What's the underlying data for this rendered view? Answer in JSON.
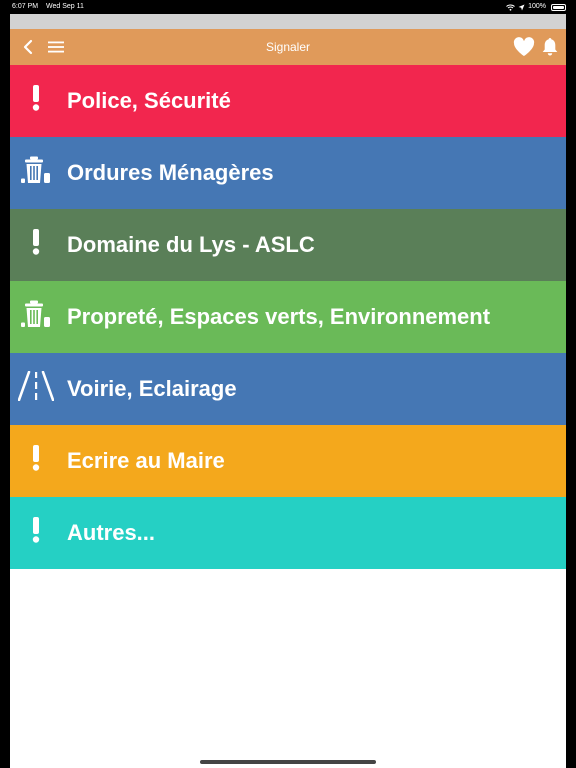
{
  "status_bar": {
    "time": "6:07 PM",
    "date": "Wed Sep 11",
    "battery": "100%"
  },
  "navbar": {
    "title": "Signaler"
  },
  "rows": [
    {
      "label": "Police, Sécurité",
      "icon": "exclamation-icon",
      "color": "#f2264e"
    },
    {
      "label": "Ordures Ménagères",
      "icon": "trash-icon",
      "color": "#4577b4"
    },
    {
      "label": "Domaine du Lys - ASLC",
      "icon": "exclamation-icon",
      "color": "#5a7f58"
    },
    {
      "label": "Propreté, Espaces verts, Environnement",
      "icon": "trash-icon",
      "color": "#6aba58"
    },
    {
      "label": "Voirie, Eclairage",
      "icon": "road-icon",
      "color": "#4577b4"
    },
    {
      "label": "Ecrire au Maire",
      "icon": "exclamation-icon",
      "color": "#f4a81c"
    },
    {
      "label": "Autres...",
      "icon": "exclamation-icon",
      "color": "#25d0c4"
    }
  ],
  "colors": {
    "navbar": "#e09a5a",
    "top_strip": "#d2d2d2"
  }
}
